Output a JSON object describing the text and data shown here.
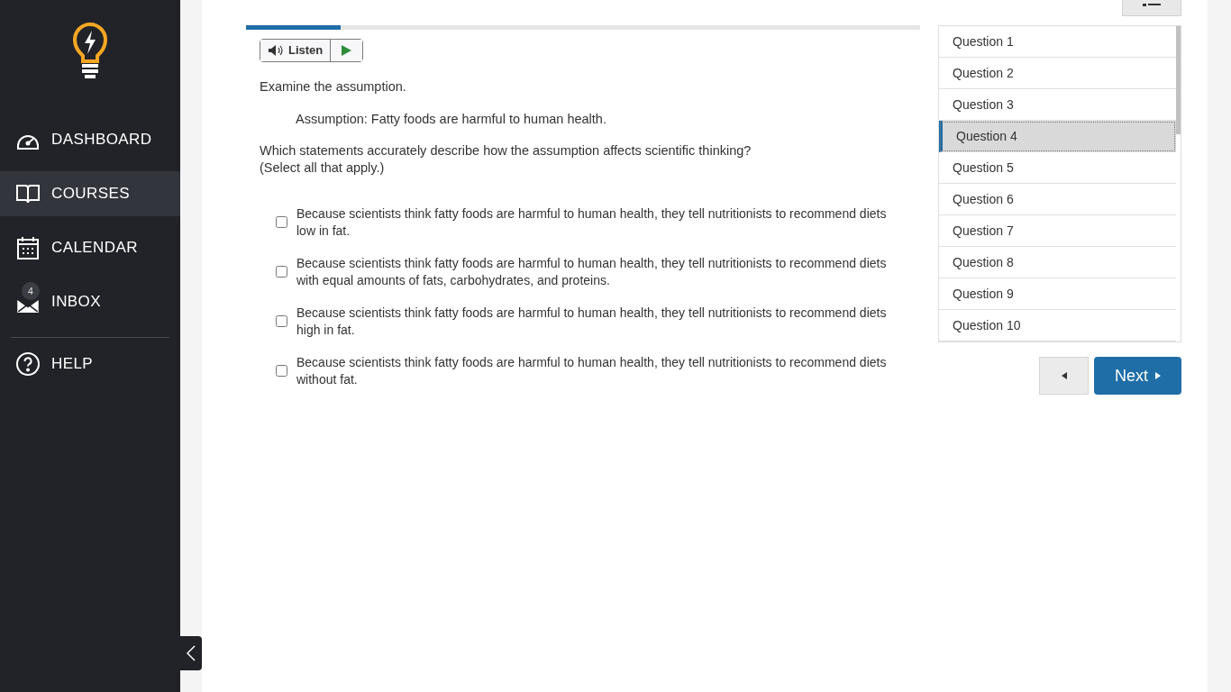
{
  "sidebar": {
    "items": [
      {
        "kind": "dashboard",
        "label": "DASHBOARD",
        "selected": false
      },
      {
        "kind": "courses",
        "label": "COURSES",
        "selected": true
      },
      {
        "kind": "calendar",
        "label": "CALENDAR",
        "selected": false
      },
      {
        "kind": "inbox",
        "label": "INBOX",
        "selected": false,
        "badge": "4"
      },
      {
        "kind": "help",
        "label": "HELP",
        "selected": false
      }
    ]
  },
  "progress": {
    "level": 0.14
  },
  "listen": {
    "label": "Listen"
  },
  "question": {
    "intro": "Examine the assumption.",
    "assumption": "Assumption: Fatty foods are harmful to human health.",
    "prompt": "Which statements accurately describe how the assumption affects scientific thinking?",
    "hint": "(Select all that apply.)"
  },
  "options": [
    {
      "text": "Because scientists think fatty foods are harmful to human health, they tell nutritionists to recommend diets low in fat.",
      "checked": false
    },
    {
      "text": "Because scientists think fatty foods are harmful to human health, they tell nutritionists to recommend diets with equal amounts of fats, carbohydrates, and proteins.",
      "checked": false
    },
    {
      "text": "Because scientists think fatty foods are harmful to human health, they tell nutritionists to recommend diets high in fat.",
      "checked": false
    },
    {
      "text": "Because scientists think fatty foods are harmful to human health, they tell nutritionists to recommend diets without fat.",
      "checked": false
    }
  ],
  "question_list": [
    {
      "label": "Question 1",
      "selected": false
    },
    {
      "label": "Question 2",
      "selected": false
    },
    {
      "label": "Question 3",
      "selected": false
    },
    {
      "label": "Question 4",
      "selected": true
    },
    {
      "label": "Question 5",
      "selected": false
    },
    {
      "label": "Question 6",
      "selected": false
    },
    {
      "label": "Question 7",
      "selected": false
    },
    {
      "label": "Question 8",
      "selected": false
    },
    {
      "label": "Question 9",
      "selected": false
    },
    {
      "label": "Question 10",
      "selected": false
    }
  ],
  "next_button": {
    "label": "Next"
  }
}
